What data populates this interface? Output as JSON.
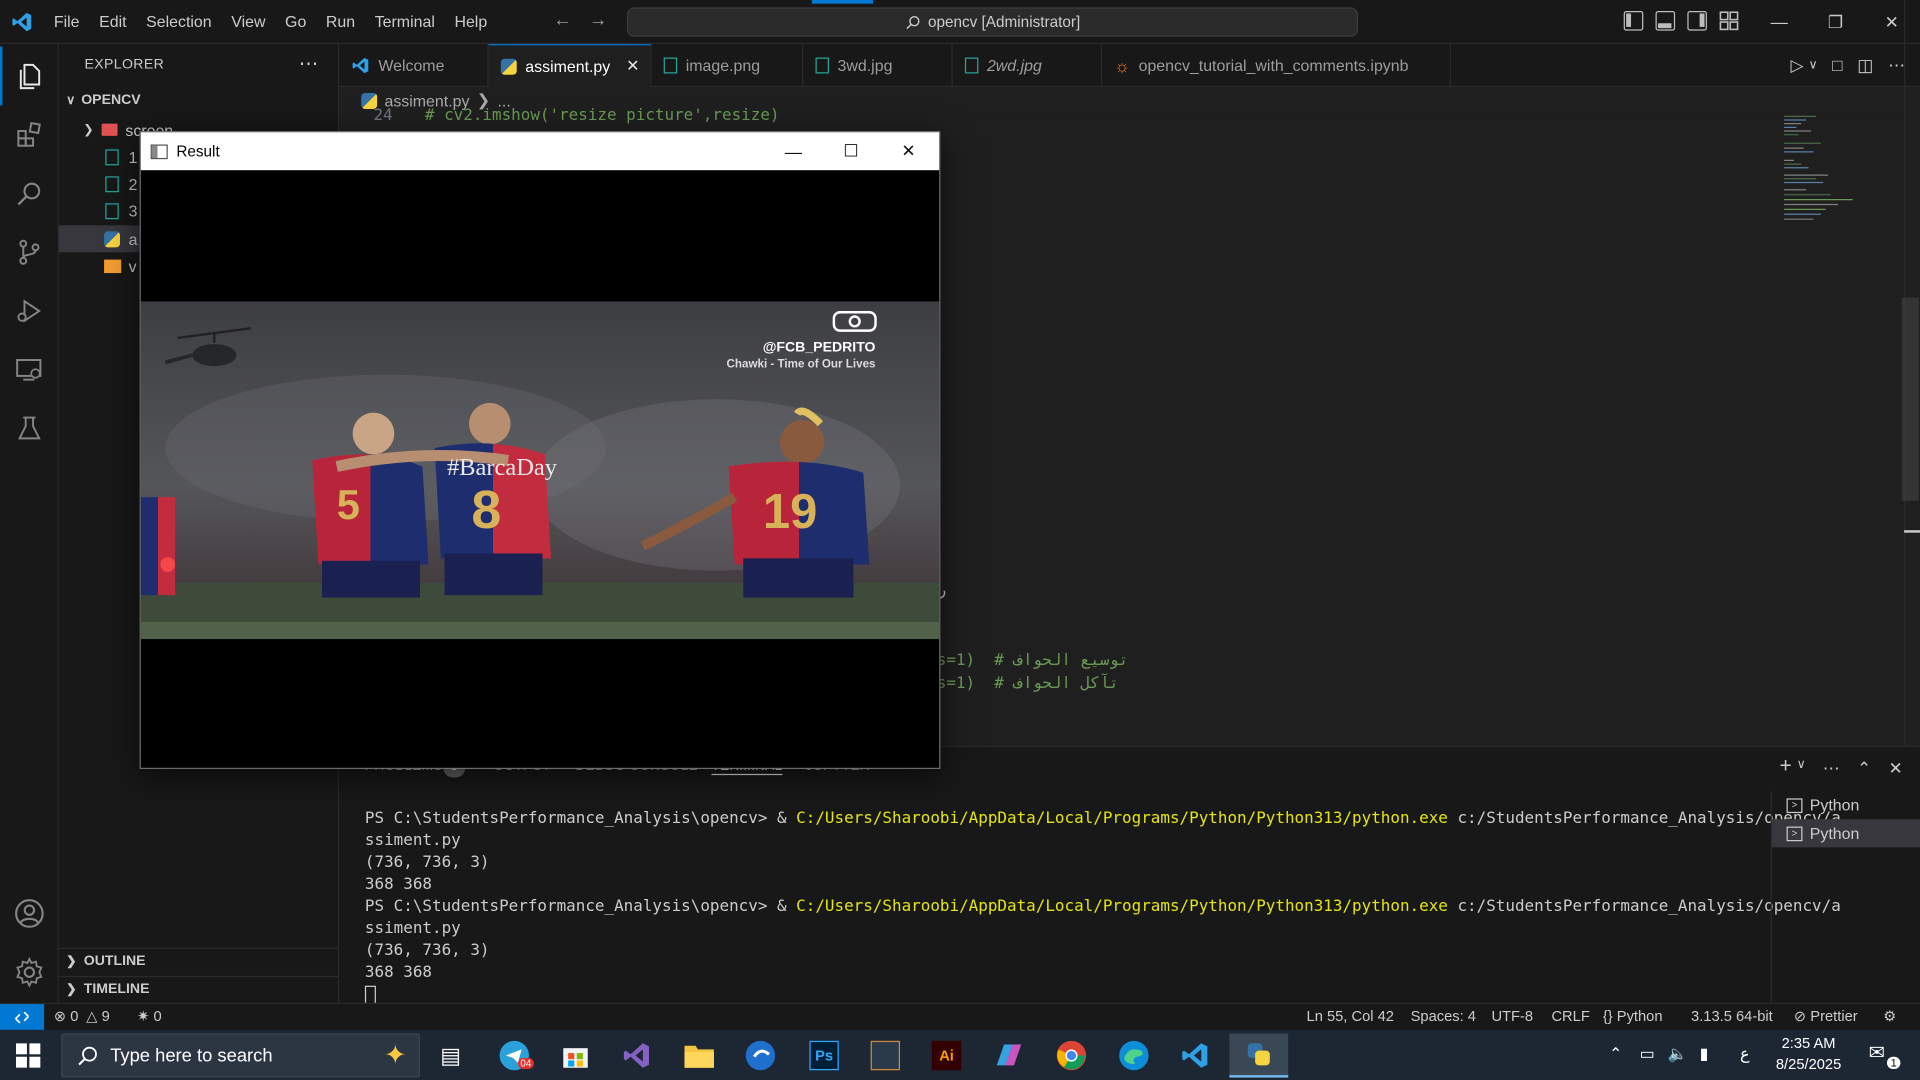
{
  "menu": [
    "File",
    "Edit",
    "Selection",
    "View",
    "Go",
    "Run",
    "Terminal",
    "Help"
  ],
  "command_center": "opencv [Administrator]",
  "sidebar": {
    "title": "EXPLORER",
    "folder": "OPENCV",
    "items": [
      {
        "label": "screen"
      },
      {
        "label": "1"
      },
      {
        "label": "2"
      },
      {
        "label": "3"
      },
      {
        "label": "a"
      },
      {
        "label": "v"
      }
    ],
    "outline": "OUTLINE",
    "timeline": "TIMELINE"
  },
  "tabs": [
    {
      "label": "Welcome"
    },
    {
      "label": "assiment.py"
    },
    {
      "label": "image.png"
    },
    {
      "label": "3wd.jpg"
    },
    {
      "label": "2wd.jpg"
    },
    {
      "label": "opencv_tutorial_with_comments.ipynb"
    }
  ],
  "breadcrumb": {
    "file": "assiment.py",
    "rest": "..."
  },
  "editor": {
    "line_top_num": "24",
    "line_top_code": "# cv2.imshow('resize picture',resize)",
    "line_a_code": "s=1)  # توسيع الحواف",
    "line_b_code": "s=1)  # تآكل الحواف",
    "line_mid_char": "ر"
  },
  "panel": {
    "tabs": [
      "PROBLEMS",
      "OUTPUT",
      "DEBUG CONSOLE",
      "TERMINAL",
      "JUPYTER"
    ],
    "problems_count": "9",
    "terminal_lines": [
      {
        "prefix": "PS C:\\StudentsPerformance_Analysis\\opencv> & ",
        "exe": "C:/Users/Sharoobi/AppData/Local/Programs/Python/Python313/python.exe",
        "arg": " c:/StudentsPerformance_Analysis/opencv/a"
      },
      {
        "text": "ssiment.py"
      },
      {
        "text": "(736, 736, 3)"
      },
      {
        "text": "368 368"
      },
      {
        "prefix": "PS C:\\StudentsPerformance_Analysis\\opencv> & ",
        "exe": "C:/Users/Sharoobi/AppData/Local/Programs/Python/Python313/python.exe",
        "arg": " c:/StudentsPerformance_Analysis/opencv/a"
      },
      {
        "text": "ssiment.py"
      },
      {
        "text": "(736, 736, 3)"
      },
      {
        "text": "368 368"
      }
    ],
    "terminals": [
      "Python",
      "Python"
    ]
  },
  "status": {
    "errors": "0",
    "warnings": "9",
    "ports": "0",
    "position": "Ln 55, Col 42",
    "spaces": "Spaces: 4",
    "encoding": "UTF-8",
    "eol": "CRLF",
    "language": "Python",
    "interpreter": "3.13.5 64-bit",
    "formatter": "Prettier"
  },
  "result_window": {
    "title": "Result",
    "photo_handle": "@FCB_PEDRITO",
    "photo_song": "Chawki - Time of Our Lives",
    "photo_hashtag": "#BarcaDay",
    "jersey_a": "5",
    "jersey_b": "8",
    "jersey_c": "19"
  },
  "taskbar": {
    "search_placeholder": "Type here to search",
    "telegram_badge": "04",
    "ps_label": "Ps",
    "ai_label": "Ai",
    "time": "2:35 AM",
    "date": "8/25/2025",
    "lang": "ع",
    "notif_count": "1"
  },
  "colors": {
    "accent": "#0078d4",
    "terminal_highlight": "#e5e510",
    "comment": "#6a9955"
  }
}
